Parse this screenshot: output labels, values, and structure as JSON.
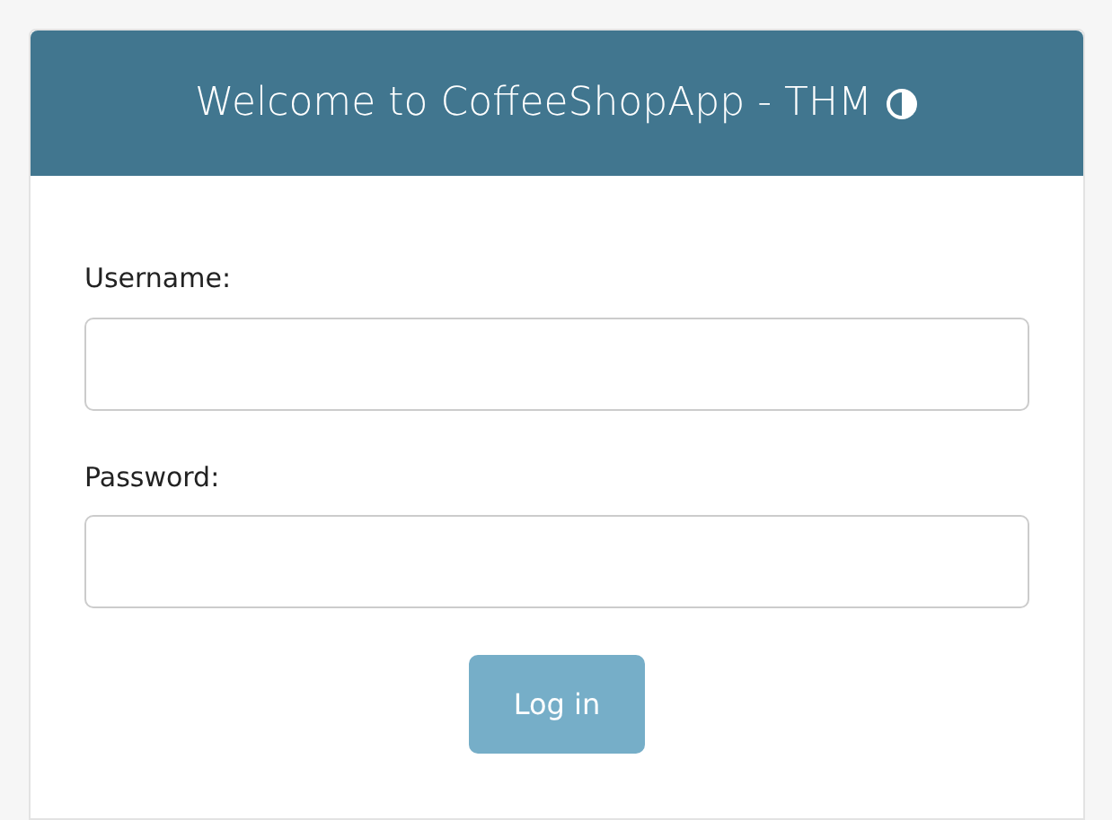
{
  "header": {
    "title": "Welcome to CoffeeShopApp - THM"
  },
  "fields": [
    {
      "label": "Username:"
    },
    {
      "label": "Password:"
    }
  ],
  "login_button": {
    "label": "Log in",
    "disabled": true
  }
}
